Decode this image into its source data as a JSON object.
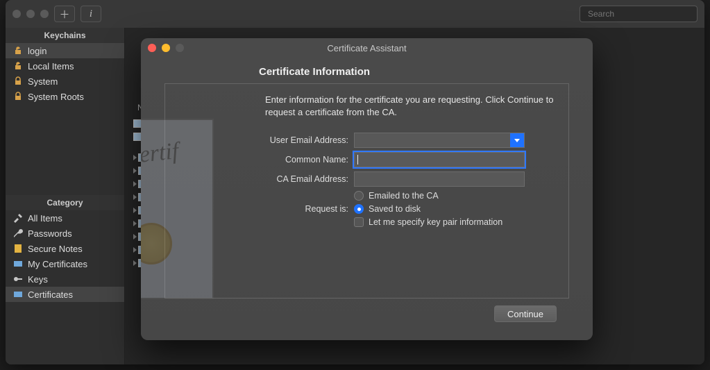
{
  "toolbar": {
    "search_placeholder": "Search"
  },
  "sidebar": {
    "keychains_header": "Keychains",
    "keychains": [
      {
        "label": "login"
      },
      {
        "label": "Local Items"
      },
      {
        "label": "System"
      },
      {
        "label": "System Roots"
      }
    ],
    "category_header": "Category",
    "categories": [
      {
        "label": "All Items"
      },
      {
        "label": "Passwords"
      },
      {
        "label": "Secure Notes"
      },
      {
        "label": "My Certificates"
      },
      {
        "label": "Keys"
      },
      {
        "label": "Certificates"
      }
    ]
  },
  "table": {
    "col_name": "Nam"
  },
  "modal": {
    "title": "Certificate Assistant",
    "heading": "Certificate Information",
    "instructions": "Enter information for the certificate you are requesting. Click Continue to request a certificate from the CA.",
    "labels": {
      "user_email": "User Email Address:",
      "common_name": "Common Name:",
      "ca_email": "CA Email Address:",
      "request_is": "Request is:"
    },
    "values": {
      "user_email": "",
      "common_name": "",
      "ca_email": ""
    },
    "radio_emailed": "Emailed to the CA",
    "radio_saved": "Saved to disk",
    "checkbox_kp": "Let me specify key pair information",
    "continue": "Continue",
    "cert_word": "Certif"
  }
}
